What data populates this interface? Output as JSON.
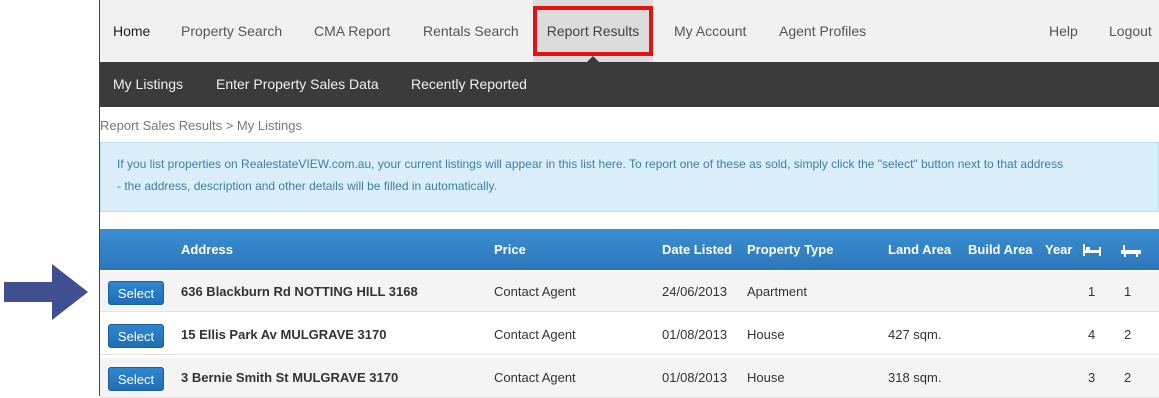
{
  "top_nav": {
    "items": [
      "Home",
      "Property Search",
      "CMA Report",
      "Rentals Search",
      "Report Results",
      "My Account",
      "Agent Profiles"
    ],
    "right": [
      "Help",
      "Logout"
    ]
  },
  "sub_nav": {
    "items": [
      "My Listings",
      "Enter Property Sales Data",
      "Recently Reported"
    ]
  },
  "breadcrumb": "Report Sales Results > My Listings",
  "alert": {
    "line1": "If you list properties on RealestateVIEW.com.au, your current listings will appear in this list here. To report one of these as sold, simply click the \"select\" button next to that address",
    "line2": "- the address, description and other details will be filled in automatically."
  },
  "table": {
    "headers": [
      "Address",
      "Price",
      "Date Listed",
      "Property Type",
      "Land Area",
      "Build Area",
      "Year"
    ],
    "rows": [
      {
        "select": "Select",
        "address": "636 Blackburn Rd NOTTING HILL 3168",
        "price": "Contact Agent",
        "date": "24/06/2013",
        "type": "Apartment",
        "land": "",
        "build": "",
        "year": "",
        "beds": "1",
        "baths": "1"
      },
      {
        "select": "Select",
        "address": "15 Ellis Park Av MULGRAVE 3170",
        "price": "Contact Agent",
        "date": "01/08/2013",
        "type": "House",
        "land": "427 sqm.",
        "build": "",
        "year": "",
        "beds": "4",
        "baths": "2"
      },
      {
        "select": "Select",
        "address": "3 Bernie Smith St MULGRAVE 3170",
        "price": "Contact Agent",
        "date": "01/08/2013",
        "type": "House",
        "land": "318 sqm.",
        "build": "",
        "year": "",
        "beds": "3",
        "baths": "2"
      }
    ]
  },
  "colors": {
    "highlight": "#e31212",
    "arrow": "#3f4f8f",
    "header_blue": "#2a77ba"
  }
}
